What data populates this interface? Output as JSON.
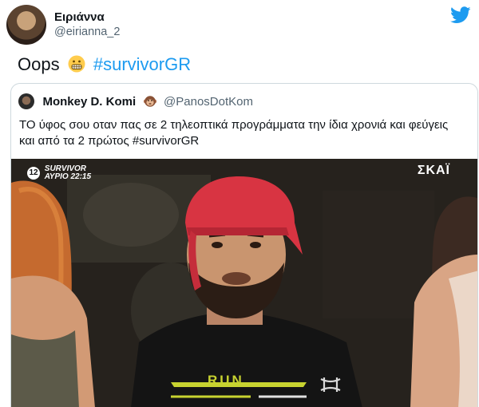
{
  "tweet": {
    "display_name": "Ειριάννα",
    "handle": "@eirianna_2",
    "text_prefix": "Oops",
    "hashtag": "#survivorGR",
    "emoji": "grimacing-face-emoji"
  },
  "quoted": {
    "display_name": "Monkey D. Komi",
    "badge": "monkey-face-emoji",
    "handle": "@PanosDotKom",
    "text": "ΤΟ ύφος σου οταν πας σε 2 τηλεοπτικά προγράμματα την ίδια χρονιά και φεύγεις και από τα 2 πρώτος #survivorGR"
  },
  "media": {
    "channel_number": "12",
    "show_name": "SURVIVOR",
    "airtime": "ΑΥΡΙΟ 22:15",
    "network_logo": "ΣΚΑΪ",
    "shirt_text": "RUN"
  },
  "colors": {
    "accent": "#1d9bf0",
    "text": "#0f1419",
    "secondary": "#536471",
    "border": "#cfd9de"
  }
}
